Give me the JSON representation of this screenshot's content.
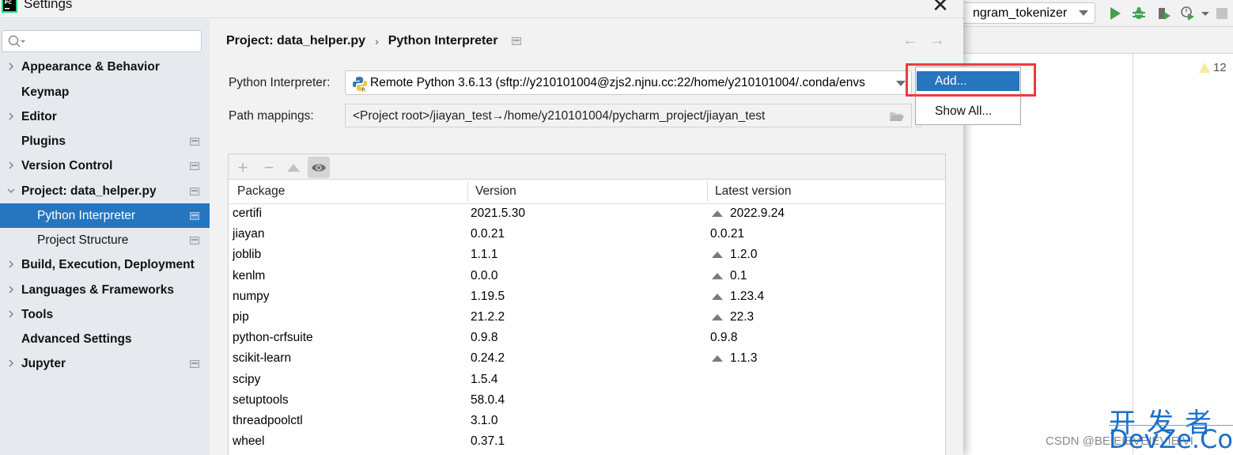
{
  "dialog": {
    "title": "Settings",
    "search_placeholder": ""
  },
  "sidebar": {
    "items": [
      {
        "label": "Appearance & Behavior",
        "expandable": true,
        "expanded": false,
        "project_level": false
      },
      {
        "label": "Keymap",
        "expandable": false,
        "project_level": false
      },
      {
        "label": "Editor",
        "expandable": true,
        "expanded": false,
        "project_level": false
      },
      {
        "label": "Plugins",
        "expandable": false,
        "project_level": true
      },
      {
        "label": "Version Control",
        "expandable": true,
        "expanded": false,
        "project_level": true
      },
      {
        "label": "Project: data_helper.py",
        "expandable": true,
        "expanded": true,
        "project_level": true
      },
      {
        "label": "Python Interpreter",
        "child": true,
        "selected": true,
        "project_level": true
      },
      {
        "label": "Project Structure",
        "child": true,
        "project_level": true
      },
      {
        "label": "Build, Execution, Deployment",
        "expandable": true,
        "expanded": false,
        "project_level": false
      },
      {
        "label": "Languages & Frameworks",
        "expandable": true,
        "expanded": false,
        "project_level": false
      },
      {
        "label": "Tools",
        "expandable": true,
        "expanded": false,
        "project_level": false
      },
      {
        "label": "Advanced Settings",
        "expandable": false,
        "project_level": false
      },
      {
        "label": "Jupyter",
        "expandable": true,
        "expanded": false,
        "project_level": true
      }
    ]
  },
  "main": {
    "breadcrumb": [
      "Project: data_helper.py",
      "Python Interpreter"
    ],
    "breadcrumb_separator": "›",
    "nav_back": "←",
    "nav_forward": "→",
    "interpreter_label": "Python Interpreter:",
    "interpreter_value": "Remote Python 3.6.13 (sftp://y210101004@zjs2.njnu.cc:22/home/y210101004/.conda/envs",
    "path_mappings_label": "Path mappings:",
    "path_mappings_value": "<Project root>/jiayan_test→/home/y210101004/pycharm_project/jiayan_test",
    "toolbar": {
      "add": "+",
      "remove": "−",
      "upgrade": "▲",
      "show_early_releases": "eye"
    },
    "table": {
      "columns": [
        "Package",
        "Version",
        "Latest version"
      ],
      "rows": [
        {
          "package": "certifi",
          "version": "2021.5.30",
          "latest": "2022.9.24",
          "upgrade": true
        },
        {
          "package": "jiayan",
          "version": "0.0.21",
          "latest": "0.0.21",
          "upgrade": false
        },
        {
          "package": "joblib",
          "version": "1.1.1",
          "latest": "1.2.0",
          "upgrade": true
        },
        {
          "package": "kenlm",
          "version": "0.0.0",
          "latest": "0.1",
          "upgrade": true
        },
        {
          "package": "numpy",
          "version": "1.19.5",
          "latest": "1.23.4",
          "upgrade": true
        },
        {
          "package": "pip",
          "version": "21.2.2",
          "latest": "22.3",
          "upgrade": true
        },
        {
          "package": "python-crfsuite",
          "version": "0.9.8",
          "latest": "0.9.8",
          "upgrade": false
        },
        {
          "package": "scikit-learn",
          "version": "0.24.2",
          "latest": "1.1.3",
          "upgrade": true
        },
        {
          "package": "scipy",
          "version": "1.5.4",
          "latest": "",
          "upgrade": false
        },
        {
          "package": "setuptools",
          "version": "58.0.4",
          "latest": "",
          "upgrade": false
        },
        {
          "package": "threadpoolctl",
          "version": "3.1.0",
          "latest": "",
          "upgrade": false
        },
        {
          "package": "wheel",
          "version": "0.37.1",
          "latest": "",
          "upgrade": false
        }
      ]
    }
  },
  "popup": {
    "items": [
      "Add...",
      "Show All..."
    ],
    "selected": "Add..."
  },
  "ide": {
    "run_config": "ngram_tokenizer",
    "warning_count": "12"
  },
  "watermark": {
    "cn": "开发者",
    "en": "DevZe.CoM",
    "csdn": "CSDN @BEIEIEVEIEVIEIVI"
  },
  "colors": {
    "selection": "#2675bf",
    "highlight_box": "#ee3a3f",
    "run_green": "#3fa34d"
  }
}
